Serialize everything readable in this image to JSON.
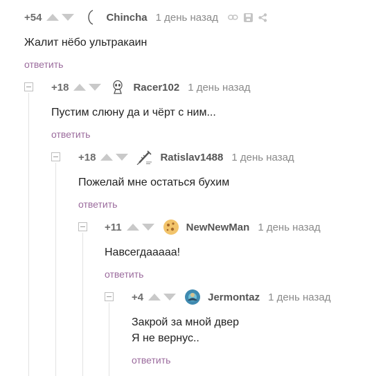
{
  "comments": [
    {
      "rating": "+54",
      "author": "Chincha",
      "time": "1 день назад",
      "text_lines": [
        "Жалит нёбо ультракаин"
      ],
      "reply_label": "ответить",
      "avatar_icon": "crescent-icon",
      "tool_icons": [
        "link-icon",
        "save-icon",
        "share-icon"
      ]
    },
    {
      "rating": "+18",
      "author": "Racer102",
      "time": "1 день назад",
      "text_lines": [
        "Пустим слюну да и чёрт с ним..."
      ],
      "reply_label": "ответить",
      "avatar_icon": "alien-icon"
    },
    {
      "rating": "+18",
      "author": "Ratislav1488",
      "time": "1 день назад",
      "text_lines": [
        "Пожелай мне остаться бухим"
      ],
      "reply_label": "ответить",
      "avatar_icon": "syringe-icon"
    },
    {
      "rating": "+11",
      "author": "NewNewMan",
      "time": "1 день назад",
      "text_lines": [
        "Навсегдааааа!"
      ],
      "reply_label": "ответить",
      "avatar_icon": "cookie-icon"
    },
    {
      "rating": "+4",
      "author": "Jermontaz",
      "time": "1 день назад",
      "text_lines": [
        "Закрой за мной двер",
        "Я не вернус.."
      ],
      "reply_label": "ответить",
      "avatar_icon": "photo-avatar-icon"
    }
  ],
  "colors": {
    "reply_link": "#9b6b9d",
    "rating": "#6d6d6d",
    "vote_arrow": "#c9c9c9",
    "author": "#555555",
    "time": "#8a8a8a"
  }
}
